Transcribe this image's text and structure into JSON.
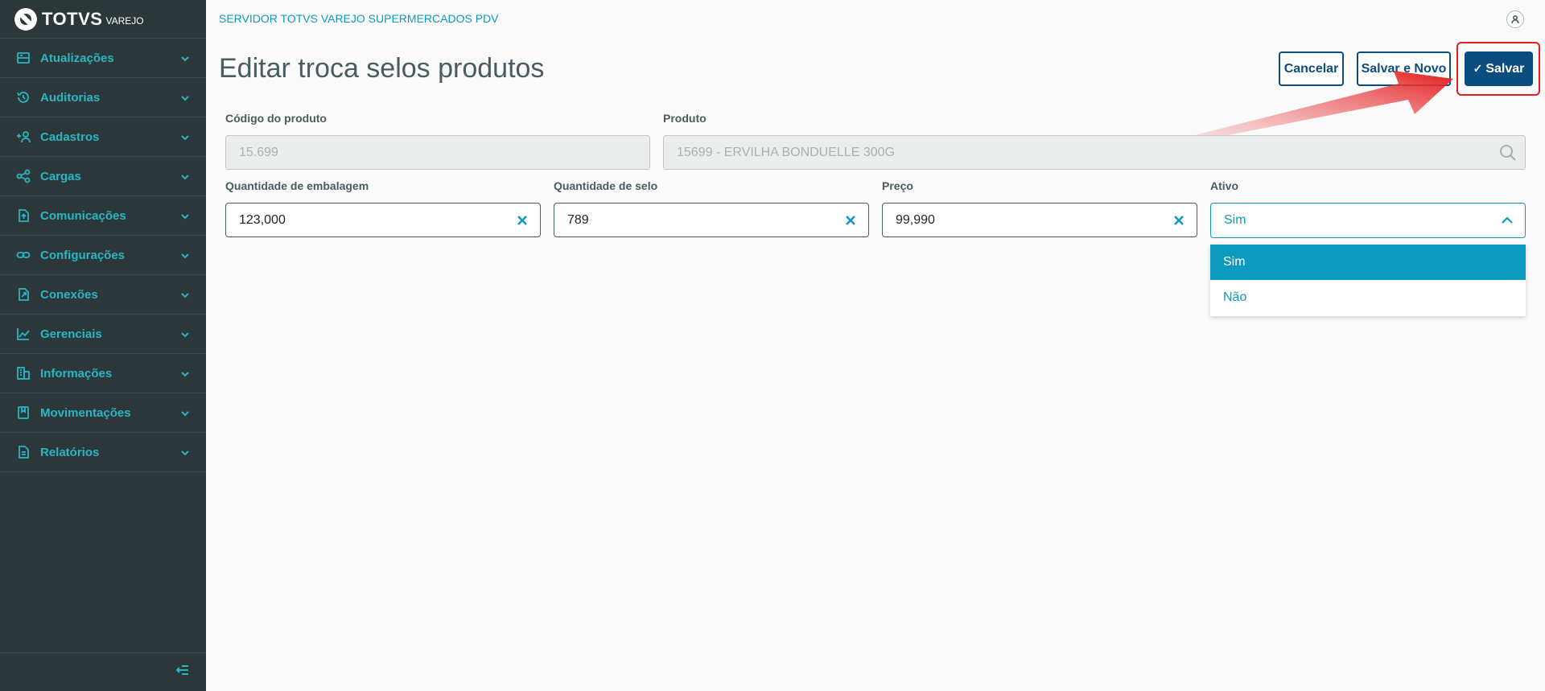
{
  "brand": {
    "name": "TOTVS",
    "sub": "VAREJO"
  },
  "sidebar": {
    "items": [
      {
        "label": "Atualizações",
        "icon": "server-icon"
      },
      {
        "label": "Auditorias",
        "icon": "history-icon"
      },
      {
        "label": "Cadastros",
        "icon": "add-user-icon"
      },
      {
        "label": "Cargas",
        "icon": "share-icon"
      },
      {
        "label": "Comunicações",
        "icon": "file-upload-icon"
      },
      {
        "label": "Configurações",
        "icon": "link-icon"
      },
      {
        "label": "Conexões",
        "icon": "file-export-icon"
      },
      {
        "label": "Gerenciais",
        "icon": "chart-icon"
      },
      {
        "label": "Informações",
        "icon": "building-icon"
      },
      {
        "label": "Movimentações",
        "icon": "book-icon"
      },
      {
        "label": "Relatórios",
        "icon": "document-icon"
      }
    ],
    "collapse_icon": "collapse-menu-icon"
  },
  "header": {
    "server": "SERVIDOR TOTVS VAREJO SUPERMERCADOS PDV"
  },
  "page": {
    "title": "Editar troca selos produtos",
    "actions": {
      "cancel": "Cancelar",
      "save_new": "Salvar e Novo",
      "save": "Salvar"
    }
  },
  "form": {
    "codigo": {
      "label": "Código do produto",
      "value": "15.699"
    },
    "produto": {
      "label": "Produto",
      "value": "15699 - ERVILHA BONDUELLE 300G"
    },
    "qtd_embalagem": {
      "label": "Quantidade de embalagem",
      "value": "123,000"
    },
    "qtd_selo": {
      "label": "Quantidade de selo",
      "value": "789"
    },
    "preco": {
      "label": "Preço",
      "value": "99,990"
    },
    "ativo": {
      "label": "Ativo",
      "value": "Sim",
      "options": [
        "Sim",
        "Não"
      ]
    }
  },
  "colors": {
    "sidebar_bg": "#2c3739",
    "accent": "#0c9abe",
    "primary": "#0b4d7e",
    "highlight": "#e32020"
  }
}
